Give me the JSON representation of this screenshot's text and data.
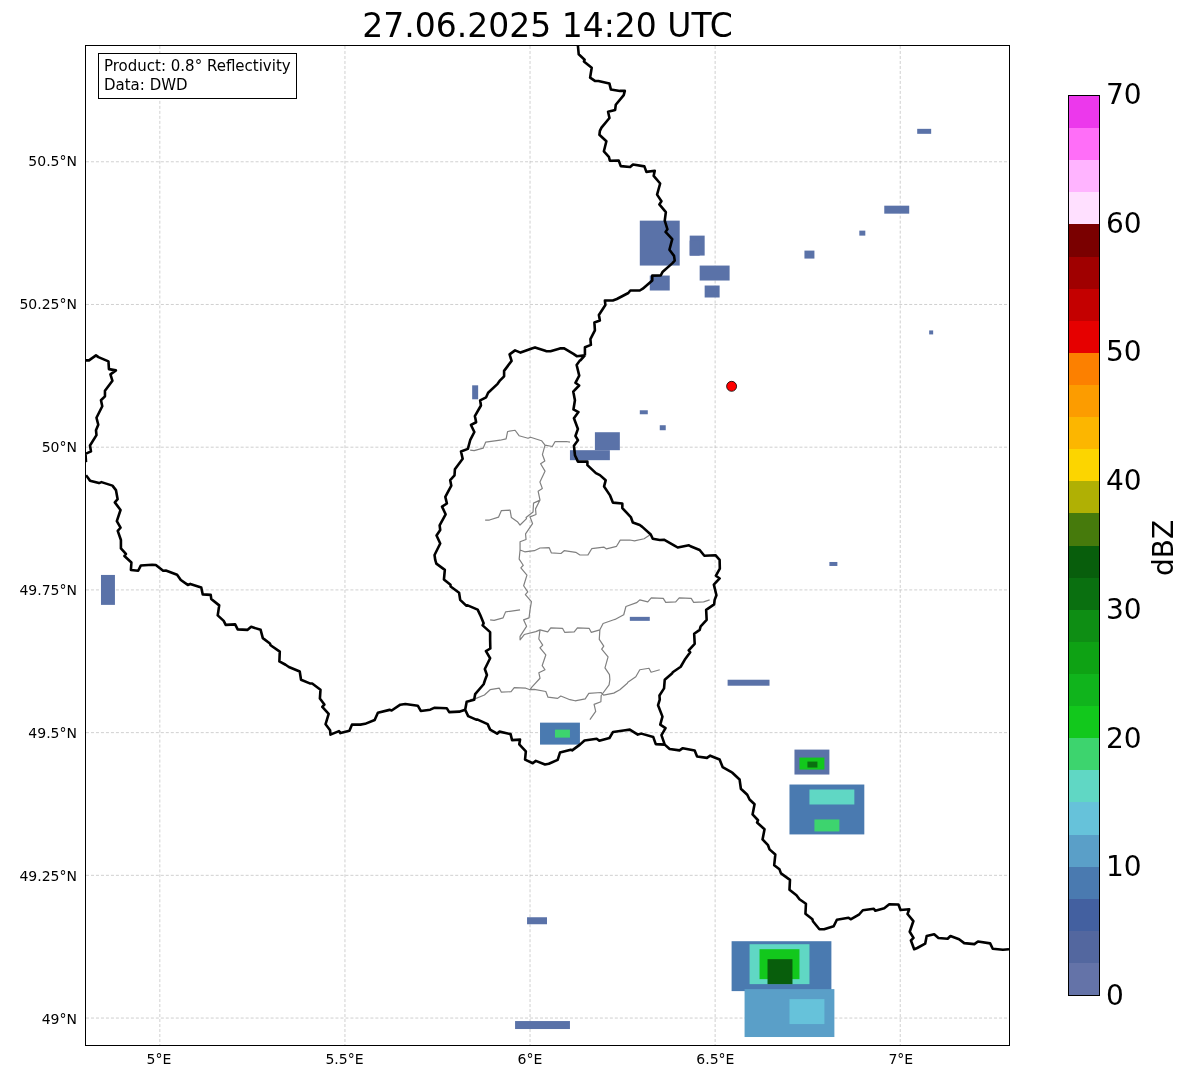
{
  "title": "27.06.2025 14:20 UTC",
  "map": {
    "info_lines": [
      "Product: 0.8° Reflectivity",
      "Data: DWD"
    ],
    "lat_ticks": [
      "50.5°N",
      "50.25°N",
      "50°N",
      "49.75°N",
      "49.5°N",
      "49.25°N",
      "49°N"
    ],
    "lon_ticks": [
      "5°E",
      "5.5°E",
      "6°E",
      "6.5°E",
      "7°E"
    ]
  },
  "colorbar": {
    "label": "dBZ",
    "ticks": [
      "70",
      "60",
      "50",
      "40",
      "30",
      "20",
      "10",
      "0"
    ],
    "bins": [
      {
        "color": "#ec38ec"
      },
      {
        "color": "#ff6ef8"
      },
      {
        "color": "#ffb4ff"
      },
      {
        "color": "#ffe0ff"
      },
      {
        "color": "#7a0000"
      },
      {
        "color": "#a00000"
      },
      {
        "color": "#c40000"
      },
      {
        "color": "#e60000"
      },
      {
        "color": "#fc8000"
      },
      {
        "color": "#fc9c00"
      },
      {
        "color": "#fcb600"
      },
      {
        "color": "#fcd500"
      },
      {
        "color": "#b0b004"
      },
      {
        "color": "#467a0c"
      },
      {
        "color": "#085e0c"
      },
      {
        "color": "#0a7010"
      },
      {
        "color": "#0e8e14"
      },
      {
        "color": "#0ea214"
      },
      {
        "color": "#10b41c"
      },
      {
        "color": "#12c81c"
      },
      {
        "color": "#3dd46e"
      },
      {
        "color": "#60d7c4"
      },
      {
        "color": "#66c2da"
      },
      {
        "color": "#5a9fc8"
      },
      {
        "color": "#4a7ab0"
      },
      {
        "color": "#4360a0"
      },
      {
        "color": "#53679f"
      },
      {
        "color": "#6473a8"
      }
    ]
  }
}
